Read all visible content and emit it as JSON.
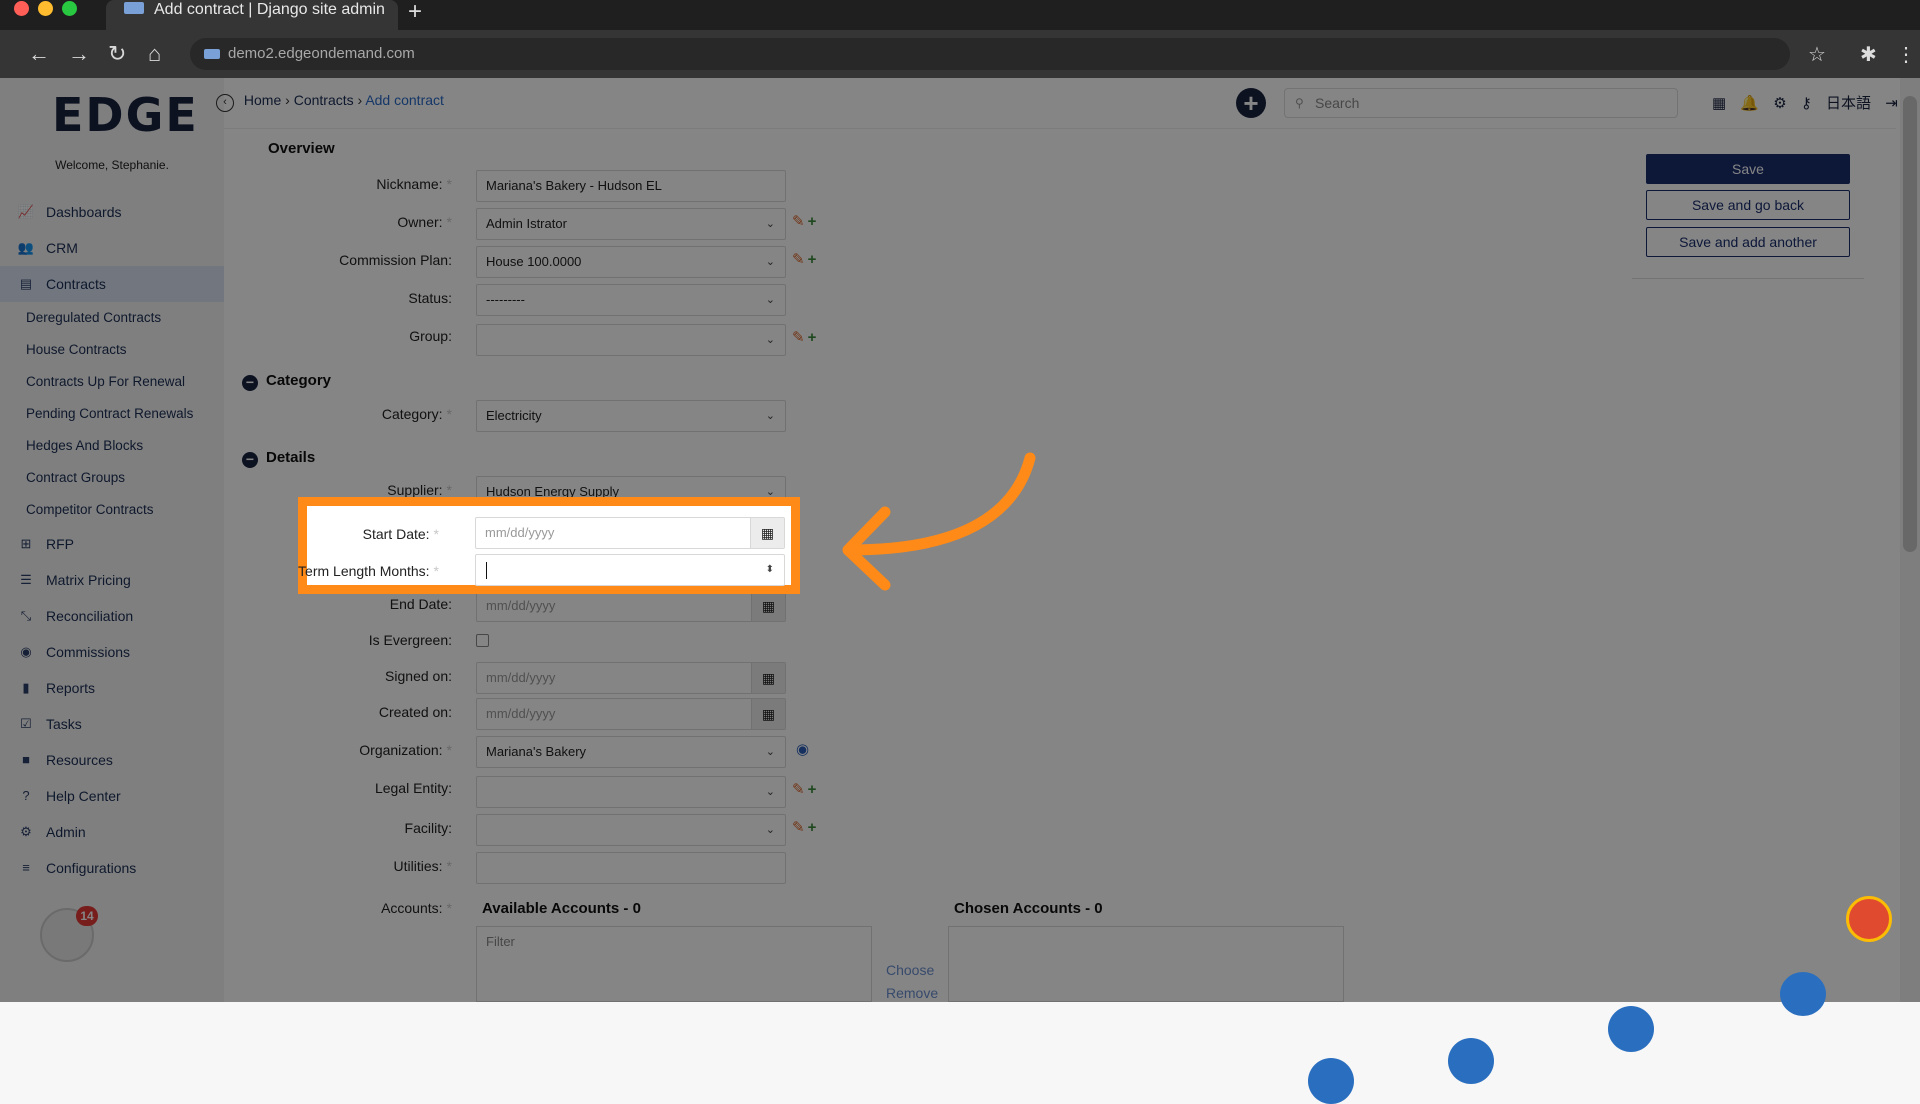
{
  "browser": {
    "tab_title": "Add contract | Django site admin",
    "url": "demo2.edgeondemand.com",
    "new_tab": "+"
  },
  "app": {
    "logo": "EDGE",
    "welcome": "Welcome, Stephanie.",
    "breadcrumb": {
      "home": "Home",
      "sep": "›",
      "section": "Contracts",
      "current": "Add contract"
    },
    "search_placeholder": "Search",
    "language": "日本語",
    "badge_count": "14"
  },
  "sidebar": {
    "items": [
      {
        "label": "Dashboards",
        "icon": "chart-line-icon"
      },
      {
        "label": "CRM",
        "icon": "users-icon"
      },
      {
        "label": "Contracts",
        "icon": "document-icon"
      },
      {
        "label": "RFP",
        "icon": "sitemap-icon"
      },
      {
        "label": "Matrix Pricing",
        "icon": "list-icon"
      },
      {
        "label": "Reconciliation",
        "icon": "compress-icon"
      },
      {
        "label": "Commissions",
        "icon": "coins-icon"
      },
      {
        "label": "Reports",
        "icon": "bar-chart-icon"
      },
      {
        "label": "Tasks",
        "icon": "tasks-icon"
      },
      {
        "label": "Resources",
        "icon": "folder-icon"
      },
      {
        "label": "Help Center",
        "icon": "question-icon"
      },
      {
        "label": "Admin",
        "icon": "cogs-icon"
      },
      {
        "label": "Configurations",
        "icon": "sliders-icon"
      }
    ],
    "sub_items": [
      "Deregulated Contracts",
      "House Contracts",
      "Contracts Up For Renewal",
      "Pending Contract Renewals",
      "Hedges And Blocks",
      "Contract Groups",
      "Competitor Contracts"
    ]
  },
  "form": {
    "overview_title": "Overview",
    "category_title": "Category",
    "details_title": "Details",
    "fields": {
      "nickname": {
        "label": "Nickname:",
        "value": "Mariana's Bakery - Hudson EL"
      },
      "owner": {
        "label": "Owner:",
        "value": "Admin Istrator"
      },
      "commission_plan": {
        "label": "Commission Plan:",
        "value": "House 100.0000"
      },
      "status": {
        "label": "Status:",
        "value": "---------"
      },
      "group": {
        "label": "Group:",
        "value": ""
      },
      "category": {
        "label": "Category:",
        "value": "Electricity"
      },
      "supplier": {
        "label": "Supplier:",
        "value": "Hudson Energy Supply"
      },
      "start_date": {
        "label": "Start Date:",
        "placeholder": "mm/dd/yyyy"
      },
      "term_length": {
        "label": "Term Length Months:",
        "value": ""
      },
      "end_date": {
        "label": "End Date:",
        "placeholder": "mm/dd/yyyy"
      },
      "is_evergreen": {
        "label": "Is Evergreen:"
      },
      "signed_on": {
        "label": "Signed on:",
        "placeholder": "mm/dd/yyyy"
      },
      "created_on": {
        "label": "Created on:",
        "placeholder": "mm/dd/yyyy"
      },
      "organization": {
        "label": "Organization:",
        "value": "Mariana's Bakery"
      },
      "legal_entity": {
        "label": "Legal Entity:",
        "value": ""
      },
      "facility": {
        "label": "Facility:",
        "value": ""
      },
      "utilities": {
        "label": "Utilities:",
        "value": ""
      },
      "accounts": {
        "label": "Accounts:"
      }
    },
    "required_mark": "*",
    "accounts": {
      "available": "Available Accounts - 0",
      "chosen": "Chosen Accounts - 0",
      "filter_placeholder": "Filter",
      "choose": "Choose",
      "remove": "Remove"
    }
  },
  "actions": {
    "save": "Save",
    "save_go_back": "Save and go back",
    "save_add_another": "Save and add another"
  },
  "colors": {
    "highlight": "#ff8a17",
    "primary": "#1a2e6e"
  }
}
